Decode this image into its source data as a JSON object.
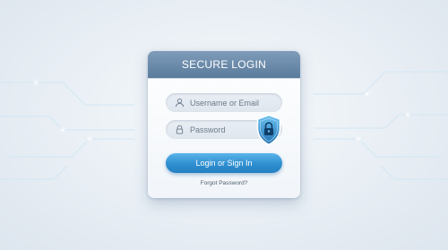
{
  "login": {
    "title": "SECURE LOGIN",
    "username_placeholder": "Username or Email",
    "password_placeholder": "Password",
    "button_label": "Login or Sign In",
    "forgot_label": "Forgot Password?"
  },
  "icons": {
    "username": "user-icon",
    "password": "lock-icon",
    "badge": "shield-lock-icon"
  },
  "colors": {
    "header": "#6a89a8",
    "button": "#2f8fd0",
    "shield": "#2e86c9",
    "circuit": "#9fd3f2"
  }
}
